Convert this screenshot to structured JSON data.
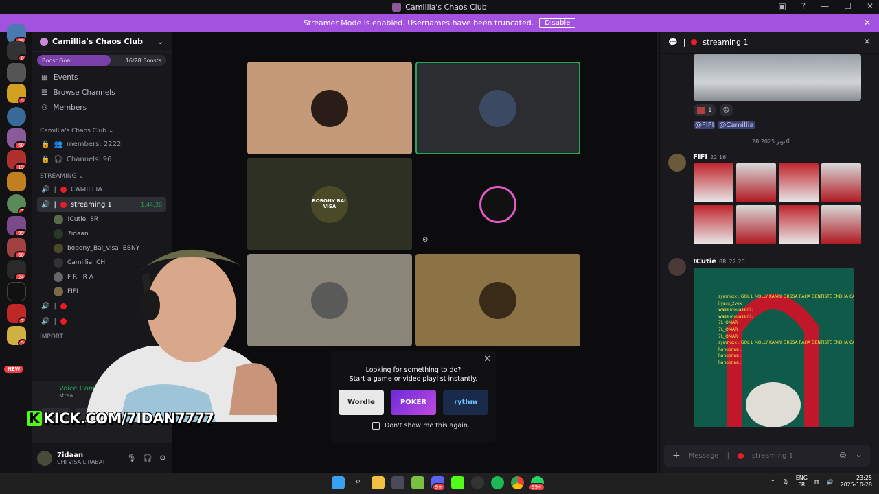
{
  "window": {
    "title": "Camillia's Chaos Club",
    "controls": [
      "—",
      "☐",
      "✕"
    ]
  },
  "banner": {
    "text": "Streamer Mode is enabled. Usernames have been truncated.",
    "button": "Disable"
  },
  "guilds": {
    "badges": [
      "28",
      "8",
      "",
      "5",
      "",
      "60",
      "19",
      "",
      "1",
      "99",
      "60",
      "24",
      "",
      "7",
      "5"
    ],
    "new_label": "NEW"
  },
  "server": {
    "name": "Camillia's Chaos Club",
    "boost_goal": "Boost Goal",
    "boosts": "16/28 Boosts",
    "boost_fraction": 0.57
  },
  "nav": [
    {
      "label": "Events",
      "icon": "calendar-icon"
    },
    {
      "label": "Browse Channels",
      "icon": "browse-icon"
    },
    {
      "label": "Members",
      "icon": "members-icon"
    }
  ],
  "category_info": "Camillia's Chaos Club",
  "info_channels": [
    "members: 2222",
    "Channels: 96"
  ],
  "category_streaming": "STREAMING",
  "channels": {
    "camillia": "CAMILLIA",
    "streaming1": "streaming 1",
    "streaming1_time": "1:44:30"
  },
  "voice_users": [
    "!Cutie",
    "7idaan",
    "bobony_Bal_visa",
    "Camillia",
    "F R I R A",
    "FIFI"
  ],
  "voice_user_tags": [
    "8R",
    "",
    "BBNY",
    "CH",
    "",
    ""
  ],
  "category_important": "IMPORT",
  "voice_connected": {
    "label": "Voice Conn",
    "sub": "strea"
  },
  "user": {
    "name": "7idaan",
    "status": "CHI VISA L RABAT"
  },
  "tiles": [
    {
      "bg": "#c49a78",
      "avatar": "#2a1d18",
      "label": ""
    },
    {
      "bg": "#2b2d31",
      "avatar": "#3b4a62",
      "label": ""
    },
    {
      "bg": "#2d3022",
      "avatar": "#4a4a28",
      "label": "BOBONY BAL VISA"
    },
    {
      "bg": "#0c0c0e",
      "avatar": "#e25ac8",
      "label": ""
    },
    {
      "bg": "#898679",
      "avatar": "#5a5a58",
      "label": ""
    },
    {
      "bg": "#8c7346",
      "avatar": "#3a2a18",
      "label": ""
    }
  ],
  "activity": {
    "line1": "Looking for something to do?",
    "line2": "Start a game or video playlist instantly.",
    "apps": [
      "Wordle",
      "POKER",
      "rythm"
    ],
    "checkbox": "Don't show me this again."
  },
  "overlay": {
    "kick": "KICK.COM/7IDAN7777"
  },
  "chat": {
    "channel": "streaming 1",
    "reaction_count": "1",
    "mentions": [
      "@FIFI",
      "@Camillia"
    ],
    "date": "28 أكتوبر 2025",
    "msg1": {
      "name": "FIFI",
      "time": "22:16"
    },
    "msg2": {
      "name": "!Cutie",
      "tag": "8R",
      "time": "22:20"
    },
    "placeholder": "Message",
    "overlay_lines": [
      "symnoxx : GOL L MOLLY KAMRI DRSSA RAHA DENTISTE ENDHA CABINET",
      "ilyass_2vex :",
      "wassimouassini :",
      "wassimouassini :",
      "7L_OMAR :",
      "7L_OMAR :",
      "7L_OMAR :",
      "symnoxx : GOL L MOLLY KAMRI DRSSA RAHA DENTISTE ENDHA CABINET",
      "hanoonaa :",
      "hanoonaa :",
      "hanoonaa :"
    ]
  },
  "taskbar": {
    "lang": "ENG",
    "region": "FR",
    "time": "23:25",
    "date": "2025-10-28",
    "badges": [
      "9+",
      "99+"
    ]
  }
}
